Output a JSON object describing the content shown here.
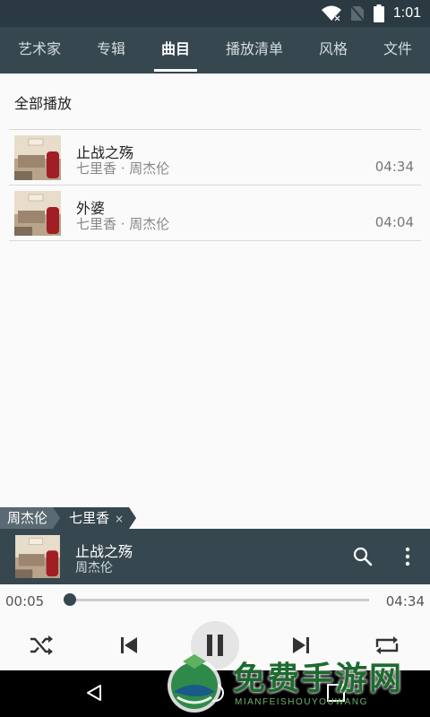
{
  "status_bar": {
    "time": "1:01"
  },
  "tabs": [
    {
      "label": "艺术家"
    },
    {
      "label": "专辑"
    },
    {
      "label": "曲目"
    },
    {
      "label": "播放清单"
    },
    {
      "label": "风格"
    },
    {
      "label": "文件"
    }
  ],
  "active_tab": "曲目",
  "play_all": "全部播放",
  "songs": [
    {
      "title": "止战之殇",
      "subtitle": "七里香 · 周杰伦",
      "duration": "04:34"
    },
    {
      "title": "外婆",
      "subtitle": "七里香 · 周杰伦",
      "duration": "04:04"
    }
  ],
  "breadcrumb": {
    "artist": "周杰伦",
    "album": "七里香",
    "close": "×"
  },
  "now_playing": {
    "title": "止战之殇",
    "artist": "周杰伦"
  },
  "progress": {
    "current": "00:05",
    "total": "04:34",
    "fraction": 0.018
  },
  "watermark": {
    "text": "免费手游网",
    "subtext": "MIANFEISHOUYOUWANG"
  },
  "colors": {
    "primary": "#36474f",
    "status_bar": "#2b3a42",
    "accent": "#ffffff"
  }
}
